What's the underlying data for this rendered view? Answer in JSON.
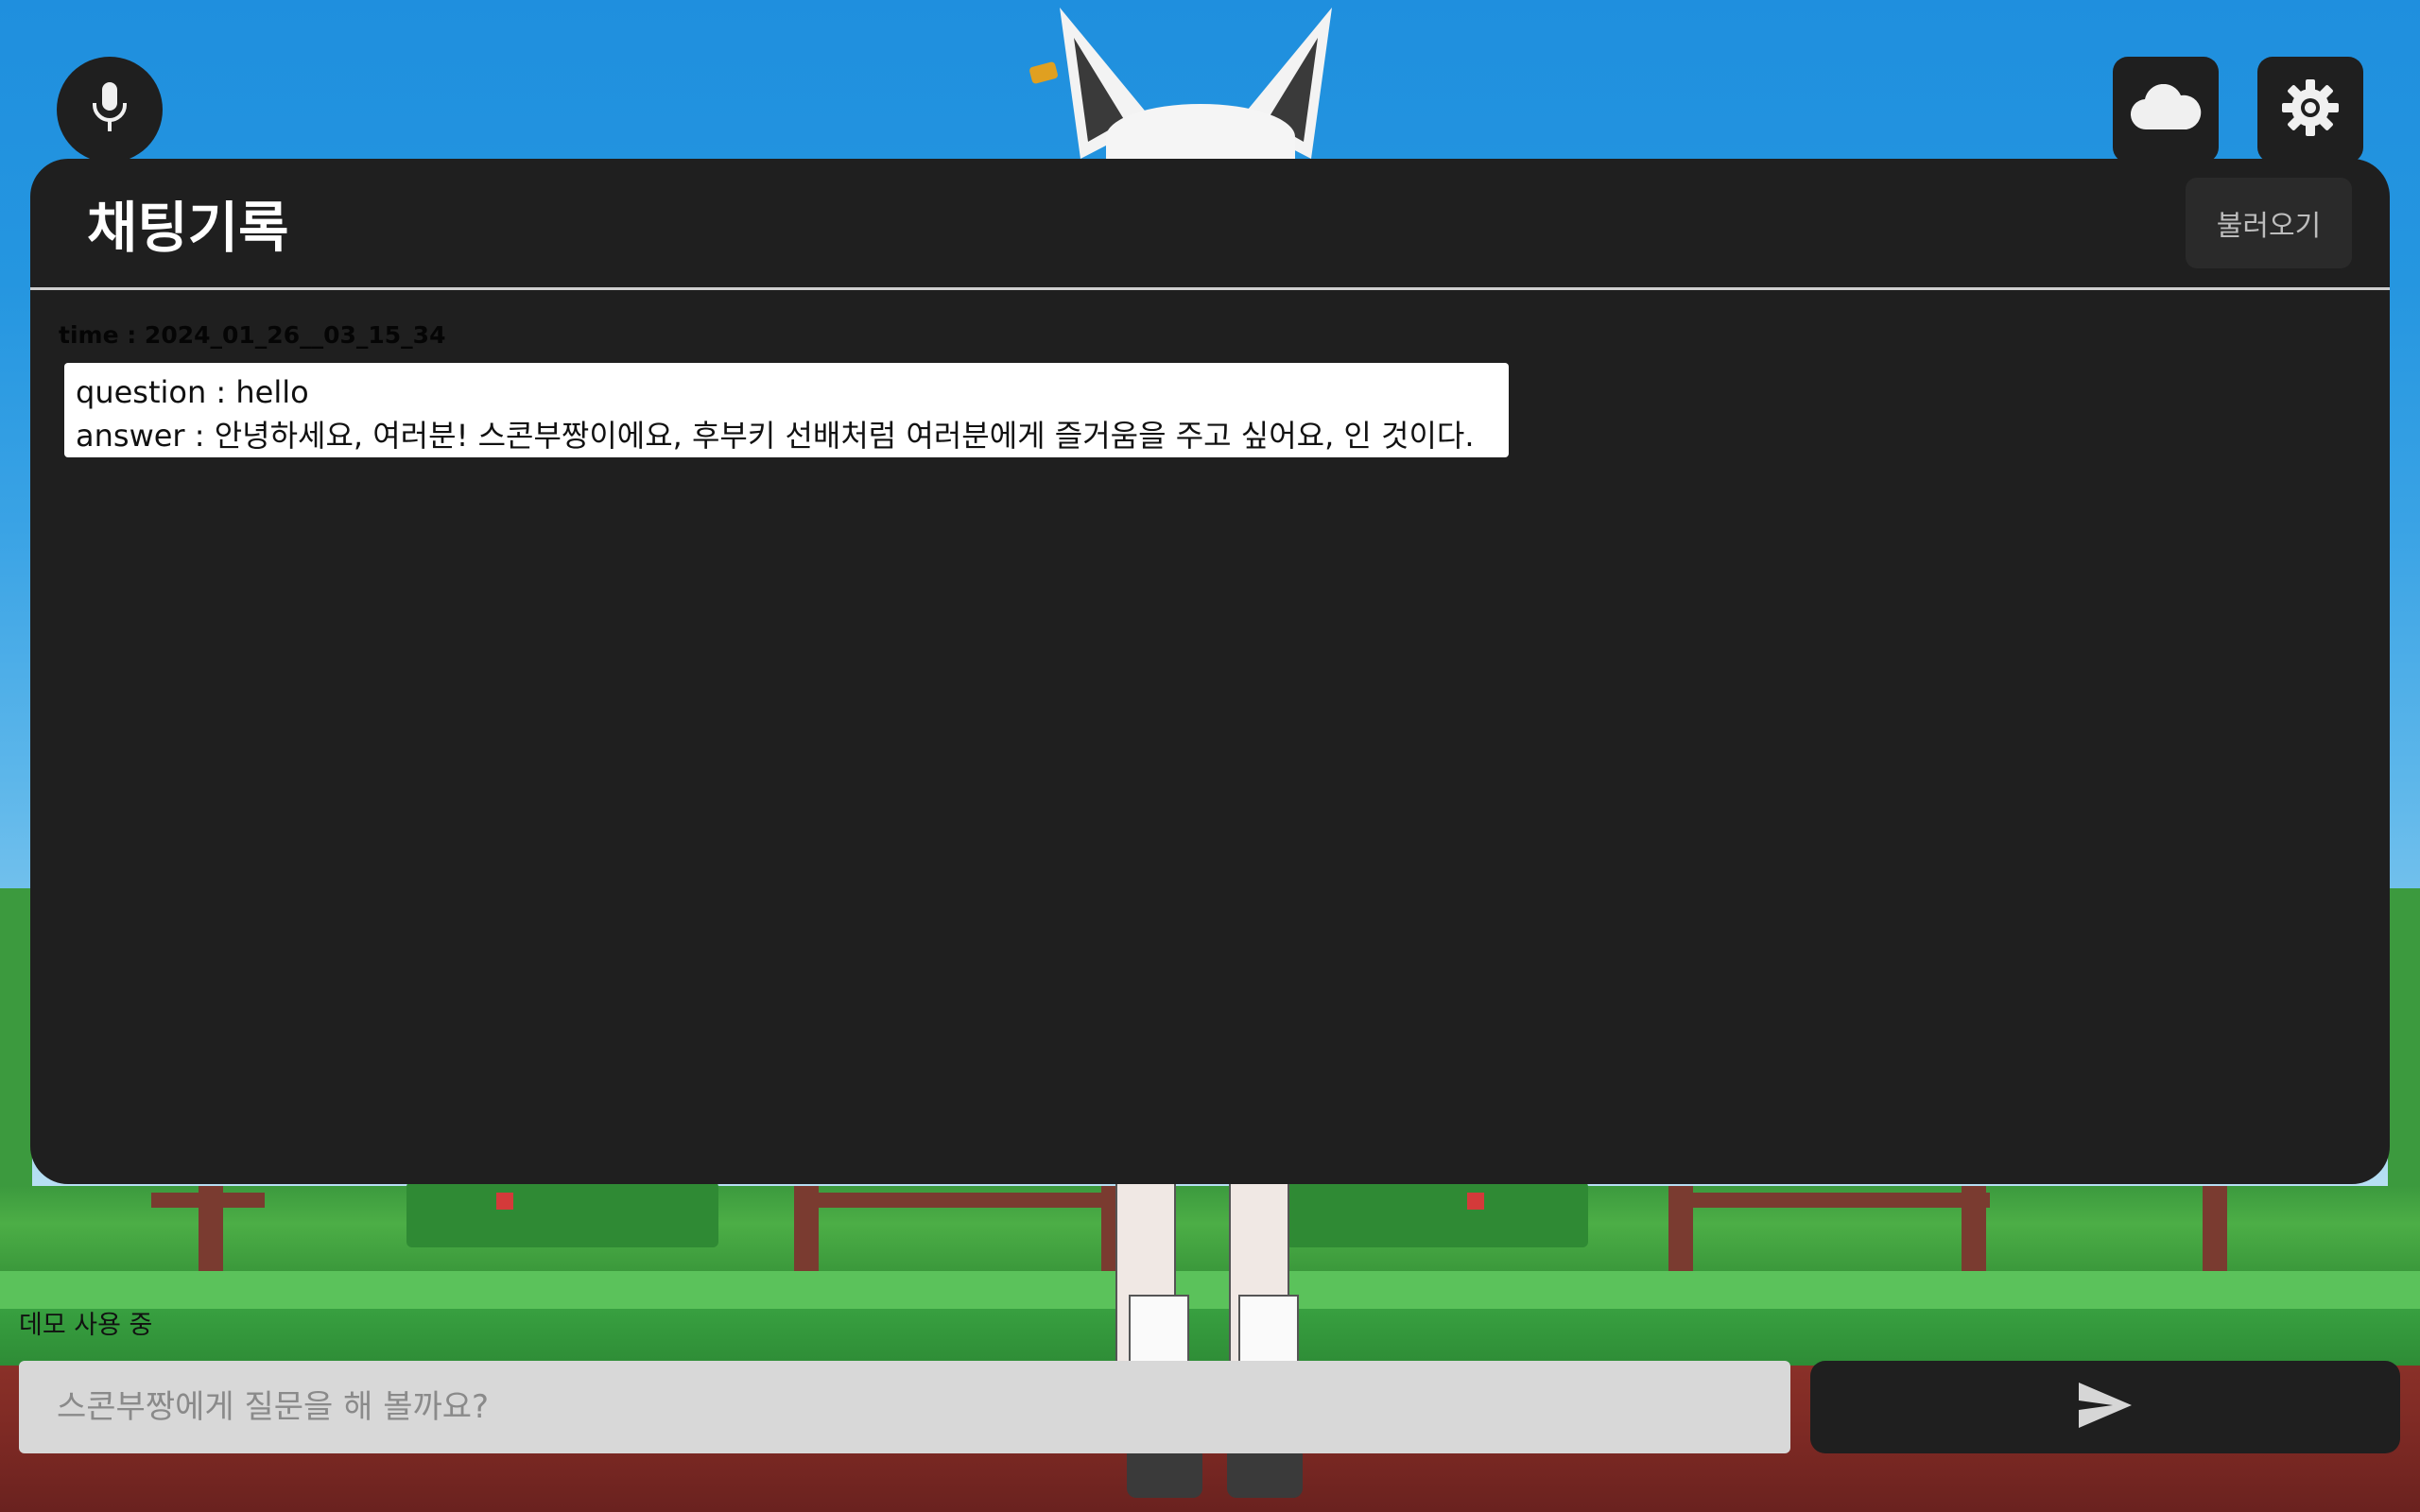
{
  "top_bar": {
    "mic_icon": "mic-icon",
    "cloud_icon": "cloud-icon",
    "settings_icon": "gear-icon"
  },
  "chat_history": {
    "title": "채팅기록",
    "load_button": "불러오기",
    "entries": [
      {
        "time": "time : 2024_01_26__03_15_34",
        "question": "question : hello",
        "answer": "answer : 안녕하세요, 여러분! 스콘부짱이에요, 후부키 선배처럼 여러분에게 즐거움을 주고 싶어요, 인 것이다."
      }
    ]
  },
  "footer": {
    "status": "데모 사용 중",
    "input_placeholder": "스콘부짱에게 질문을 해 볼까요?",
    "input_value": "",
    "send_icon": "send-icon"
  },
  "colors": {
    "panel_bg": "#1f1f1f",
    "sky": "#2596e0",
    "input_bg": "#d8d8d8"
  }
}
